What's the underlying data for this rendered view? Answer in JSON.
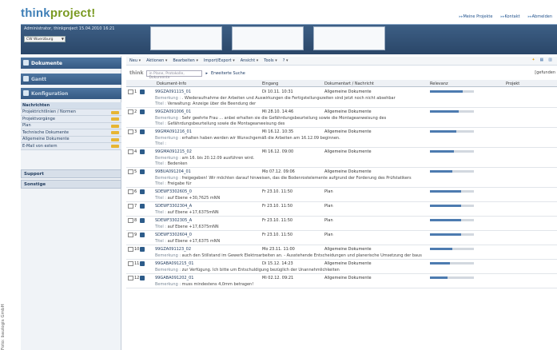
{
  "app": {
    "logo_part1": "think",
    "logo_part2": "project!"
  },
  "topnav": [
    "Meine Projekte",
    "Kontakt",
    "Abmelden"
  ],
  "header": {
    "userline": "Administrator, thinkproject 15.04.2010 16:21",
    "project_select": "CW Wuerzburg"
  },
  "sidebar": {
    "panels": [
      {
        "label": "Dokumente"
      },
      {
        "label": "Gantt"
      },
      {
        "label": "Konfiguration"
      }
    ],
    "tree": [
      {
        "label": "Nachrichten"
      },
      {
        "label": "Projektrichtlinien / Normen"
      },
      {
        "label": "Projektvorgänge"
      },
      {
        "label": "Plan"
      },
      {
        "label": "Technische Dokumente"
      },
      {
        "label": "Allgemeine Dokumente"
      },
      {
        "label": "E-Mail von extern"
      }
    ],
    "sections": [
      "Support",
      "Sonstige"
    ]
  },
  "toolbar": {
    "items": [
      "Neu",
      "Aktionen",
      "Bearbeiten",
      "Import/Export",
      "Ansicht",
      "Tools",
      "?"
    ]
  },
  "search": {
    "brand": "think",
    "placeholder": "in Plane, Protokolle, Dokumente",
    "button": "Erweiterte Suche",
    "found": "[gefunden"
  },
  "table": {
    "headers": [
      "Dokument-Info",
      "Eingang",
      "Dokumentart / Nachricht",
      "Relevanz",
      "Projekt"
    ],
    "rows": [
      {
        "n": "1",
        "id": "99GZA091115_01",
        "date": "Di 10.11. 10:31",
        "art": "Allgemeine Dokumente",
        "rel": 0.75,
        "l2_label": "Bemerkung :",
        "l2": ". Wiederaufnahme der Arbeiten und Auswirkungen die Fertigstellungszeiten sind jetzt noch nicht absehbar",
        "l3_label": "Titel :",
        "l3": "Verwaltung: Anzeige über die Beendung der"
      },
      {
        "n": "2",
        "id": "99GZA091006_01",
        "date": "Mi 28.10. 14:46",
        "art": "Allgemeine Dokumente",
        "rel": 0.65,
        "l2_label": "Bemerkung :",
        "l2": "Sehr geehrte Frau ... anbei erhalten sie die Gefährdungsbeurteilung sowie die Montageanweisung des",
        "l3_label": "Titel :",
        "l3": "Gefährdungsbeurteilung sowie die Montageanweisung des"
      },
      {
        "n": "3",
        "id": "99GMA091216_01",
        "date": "Mi 16.12. 10:35",
        "art": "Allgemeine Dokumente",
        "rel": 0.6,
        "l2_label": "Bemerkung :",
        "l2": "erhalten haben werden wir Wunschgemäß die Arbeiten am 16.12.09 beginnen.",
        "l3_label": "Titel :",
        "l3": ""
      },
      {
        "n": "4",
        "id": "99GMA091215_02",
        "date": "Mi 16.12. 09:00",
        "art": "Allgemeine Dokumente",
        "rel": 0.55,
        "l2_label": "Bemerkung :",
        "l2": "am 16. bis 20.12.09 ausführen wird.",
        "l3_label": "Titel :",
        "l3": "Bedenken"
      },
      {
        "n": "5",
        "id": "99BUA091204_01",
        "date": "Mo 07.12. 09:06",
        "art": "Allgemeine Dokumente",
        "rel": 0.5,
        "l2_label": "Bemerkung :",
        "l2": "freigegeben! Wir möchten darauf hinweisen, das die Bodenrostelemente aufgrund der Forderung des Prüfstatikers",
        "l3_label": "Titel :",
        "l3": "Freigabe für"
      },
      {
        "n": "6",
        "id": "SDEWF3302605_0",
        "date": "Fr 23.10. 11:50",
        "art": "Plan",
        "rel": 0.7,
        "l2_label": "Titel :",
        "l2": "auf Ebene +30,7625 mNN",
        "l3_label": "",
        "l3": ""
      },
      {
        "n": "7",
        "id": "SDEWF3302304_A",
        "date": "Fr 23.10. 11:50",
        "art": "Plan",
        "rel": 0.7,
        "l2_label": "Titel :",
        "l2": "auf Ebene +17,6375mNN",
        "l3_label": "",
        "l3": ""
      },
      {
        "n": "8",
        "id": "SDEWF3302305_A",
        "date": "Fr 23.10. 11:50",
        "art": "Plan",
        "rel": 0.7,
        "l2_label": "Titel :",
        "l2": "auf Ebene +17,6375mNN",
        "l3_label": "",
        "l3": ""
      },
      {
        "n": "9",
        "id": "SDEWF3302604_0",
        "date": "Fr 23.10. 11:50",
        "art": "Plan",
        "rel": 0.7,
        "l2_label": "Titel :",
        "l2": "auf Ebene +17,6375 mNN",
        "l3_label": "",
        "l3": ""
      },
      {
        "n": "10",
        "id": "99GZA091123_02",
        "date": "Mo 23.11. 11:00",
        "art": "Allgemeine Dokumente",
        "rel": 0.5,
        "l2_label": "Bemerkung :",
        "l2": "auch den Stillstand im Gewerk Elektroarbeiten an. - Ausstehende Entscheidungen und planerische Umsetzung der baus",
        "l3_label": "",
        "l3": ""
      },
      {
        "n": "11",
        "id": "99GABA091215_01",
        "date": "Di 15.12. 14:23",
        "art": "Allgemeine Dokumente",
        "rel": 0.45,
        "l2_label": "Bemerkung :",
        "l2": "zur Verfügung. Ich bitte um Entschuldigung bezüglich der Unannehmlichkeiten",
        "l3_label": "",
        "l3": ""
      },
      {
        "n": "12",
        "id": "99GABA091202_01",
        "date": "Mi 02.12. 09:21",
        "art": "Allgemeine Dokumente",
        "rel": 0.4,
        "l2_label": "Bemerkung :",
        "l2": "muss mindestens 4,0mm betragen!",
        "l3_label": "",
        "l3": ""
      }
    ]
  },
  "credit": "Foto: baulogis GmbH",
  "colors": {
    "header": "#2a4668",
    "accent": "#3f7fb7",
    "bar": "#4d7bb0",
    "highlight": "#f3c66a"
  }
}
